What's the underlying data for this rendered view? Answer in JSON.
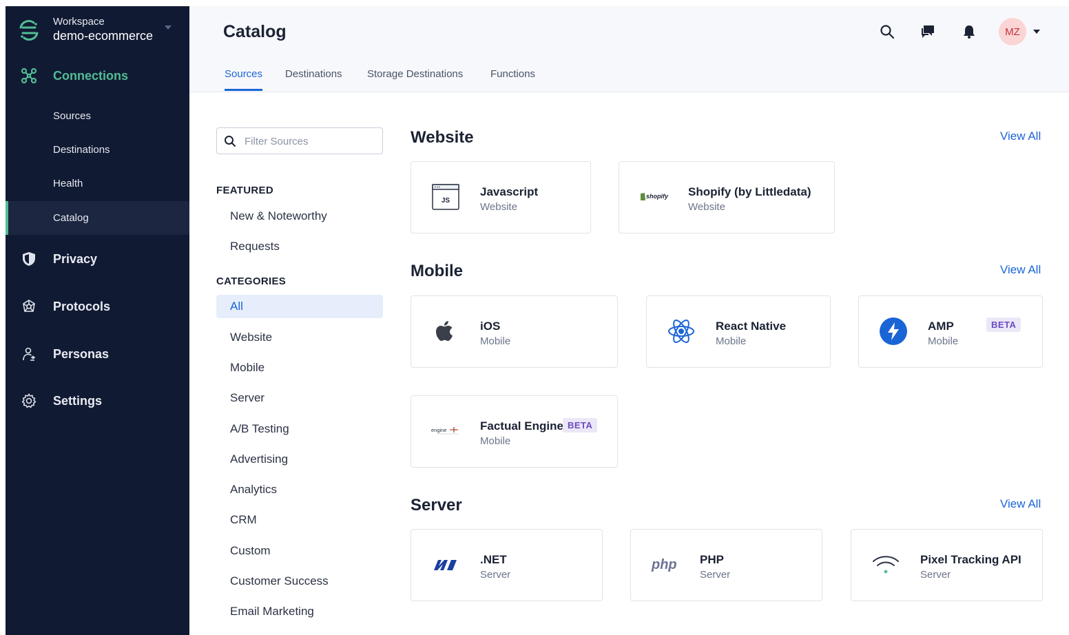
{
  "workspace": {
    "label": "Workspace",
    "name": "demo-ecommerce"
  },
  "sidebar": {
    "main": [
      {
        "label": "Connections",
        "icon": "connections-icon",
        "active": true
      },
      {
        "label": "Privacy",
        "icon": "shield-icon"
      },
      {
        "label": "Protocols",
        "icon": "protocols-icon"
      },
      {
        "label": "Personas",
        "icon": "personas-icon"
      },
      {
        "label": "Settings",
        "icon": "gear-icon"
      }
    ],
    "sub": [
      {
        "label": "Sources"
      },
      {
        "label": "Destinations"
      },
      {
        "label": "Health"
      },
      {
        "label": "Catalog",
        "selected": true
      }
    ]
  },
  "header": {
    "title": "Catalog",
    "avatar": "MZ",
    "tabs": [
      {
        "label": "Sources",
        "active": true
      },
      {
        "label": "Destinations"
      },
      {
        "label": "Storage Destinations"
      },
      {
        "label": "Functions"
      }
    ]
  },
  "filter": {
    "placeholder": "Filter Sources",
    "value": ""
  },
  "featured": {
    "heading": "FEATURED",
    "items": [
      "New & Noteworthy",
      "Requests"
    ]
  },
  "categories": {
    "heading": "CATEGORIES",
    "items": [
      "All",
      "Website",
      "Mobile",
      "Server",
      "A/B Testing",
      "Advertising",
      "Analytics",
      "CRM",
      "Custom",
      "Customer Success",
      "Email Marketing"
    ],
    "active": "All"
  },
  "groups": {
    "view_all": "View All",
    "website": {
      "title": "Website",
      "cards": [
        {
          "name": "Javascript",
          "category": "Website",
          "logo": "js-icon"
        },
        {
          "name": "Shopify (by Littledata)",
          "category": "Website",
          "logo": "shopify-logo",
          "logo_text": "shopify"
        }
      ]
    },
    "mobile": {
      "title": "Mobile",
      "cards": [
        {
          "name": "iOS",
          "category": "Mobile",
          "logo": "apple-icon"
        },
        {
          "name": "React Native",
          "category": "Mobile",
          "logo": "react-icon"
        },
        {
          "name": "AMP",
          "category": "Mobile",
          "logo": "amp-icon",
          "badge": "BETA"
        },
        {
          "name": "Factual Engine",
          "category": "Mobile",
          "logo": "engine-logo",
          "logo_text": "engine",
          "badge": "BETA"
        }
      ]
    },
    "server": {
      "title": "Server",
      "cards": [
        {
          "name": ".NET",
          "category": "Server",
          "logo": "dotnet-icon"
        },
        {
          "name": "PHP",
          "category": "Server",
          "logo": "php-logo",
          "logo_text": "php"
        },
        {
          "name": "Pixel Tracking API",
          "category": "Server",
          "logo": "wifi-icon"
        }
      ]
    }
  },
  "colors": {
    "sidebar": "#111a33",
    "accent": "#1a65d6",
    "active_green": "#52bd94",
    "beta_bg": "#ece7f7",
    "beta_text": "#6b4bc1"
  }
}
